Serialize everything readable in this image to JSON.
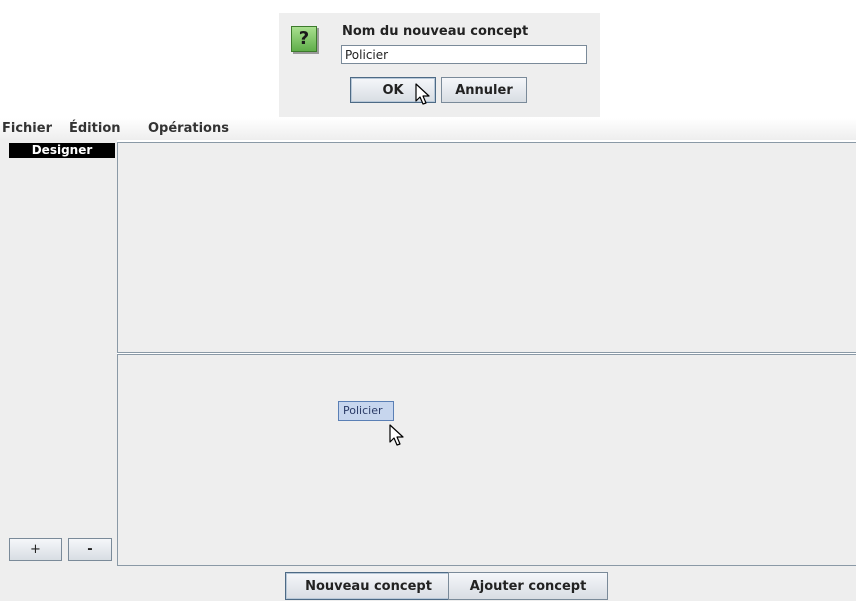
{
  "dialog": {
    "icon_name": "question-icon",
    "icon_glyph": "?",
    "prompt": "Nom du nouveau concept",
    "input_value": "Policier",
    "ok_label": "OK",
    "cancel_label": "Annuler"
  },
  "menubar": {
    "items": [
      {
        "label": "Fichier"
      },
      {
        "label": "Édition"
      },
      {
        "label": "Opérations"
      }
    ]
  },
  "sidebar": {
    "tab_label": "Designer",
    "add_label": "+",
    "remove_label": "-"
  },
  "canvas": {
    "concepts": [
      {
        "label": "Policier"
      }
    ]
  },
  "footer": {
    "new_concept_label": "Nouveau concept",
    "add_concept_label": "Ajouter concept"
  },
  "colors": {
    "accent": "#5a7fb5",
    "node_fill": "#c7d6ee",
    "icon_green": "#5fae4a",
    "panel_bg": "#eeeeee"
  },
  "icons": {
    "cursor": "mouse-pointer-icon"
  }
}
